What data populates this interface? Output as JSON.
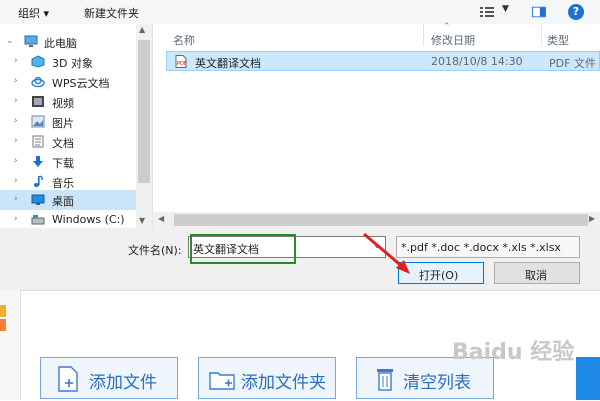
{
  "toolbar": {
    "organize": "组织 ▾",
    "new_folder": "新建文件夹"
  },
  "nav": {
    "items": [
      {
        "label": "此电脑",
        "chev": "⌄",
        "icon": "computer-icon"
      },
      {
        "label": "3D 对象",
        "chev": "›",
        "icon": "cube-icon"
      },
      {
        "label": "WPS云文档",
        "chev": "›",
        "icon": "cloud-icon"
      },
      {
        "label": "视频",
        "chev": "›",
        "icon": "video-icon"
      },
      {
        "label": "图片",
        "chev": "›",
        "icon": "picture-icon"
      },
      {
        "label": "文档",
        "chev": "›",
        "icon": "document-icon"
      },
      {
        "label": "下载",
        "chev": "›",
        "icon": "download-icon"
      },
      {
        "label": "音乐",
        "chev": "›",
        "icon": "music-icon"
      },
      {
        "label": "桌面",
        "chev": "›",
        "icon": "desktop-icon"
      },
      {
        "label": "Windows (C:)",
        "chev": "›",
        "icon": "drive-icon"
      }
    ]
  },
  "list": {
    "columns": {
      "name": "名称",
      "date": "修改日期",
      "type": "类型"
    },
    "rows": [
      {
        "name": "英文翻译文档",
        "date": "2018/10/8 14:30",
        "type": "PDF 文件"
      }
    ]
  },
  "filename": {
    "label": "文件名(N):",
    "value": "英文翻译文档"
  },
  "filter": {
    "value": "*.pdf *.doc *.docx *.xls *.xlsx"
  },
  "buttons": {
    "open": "打开(O)",
    "cancel": "取消"
  },
  "app": {
    "add_file": "添加文件",
    "add_folder": "添加文件夹",
    "clear_list": "清空列表"
  },
  "watermark": "Baidu 经验",
  "colors": {
    "accent": "#0078d7",
    "selection": "#cce8ff",
    "highlight_box": "#2a8a2a"
  }
}
